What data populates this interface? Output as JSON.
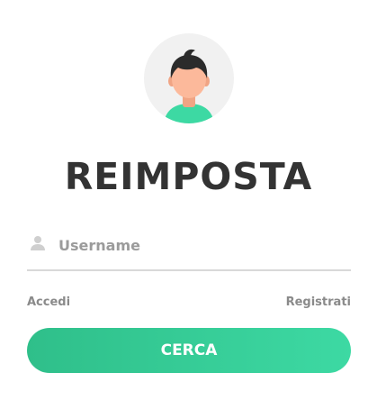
{
  "avatar": {
    "icon": "user-avatar-icon"
  },
  "title": "REIMPOSTA",
  "username_field": {
    "icon": "user-icon",
    "value": "",
    "placeholder": "Username"
  },
  "links": {
    "login": "Accedi",
    "register": "Registrati"
  },
  "submit": {
    "label": "CERCA"
  },
  "colors": {
    "accent_start": "#2fbf8a",
    "accent_end": "#3dd9a3",
    "title": "#333333",
    "muted": "#8a8a8a"
  }
}
